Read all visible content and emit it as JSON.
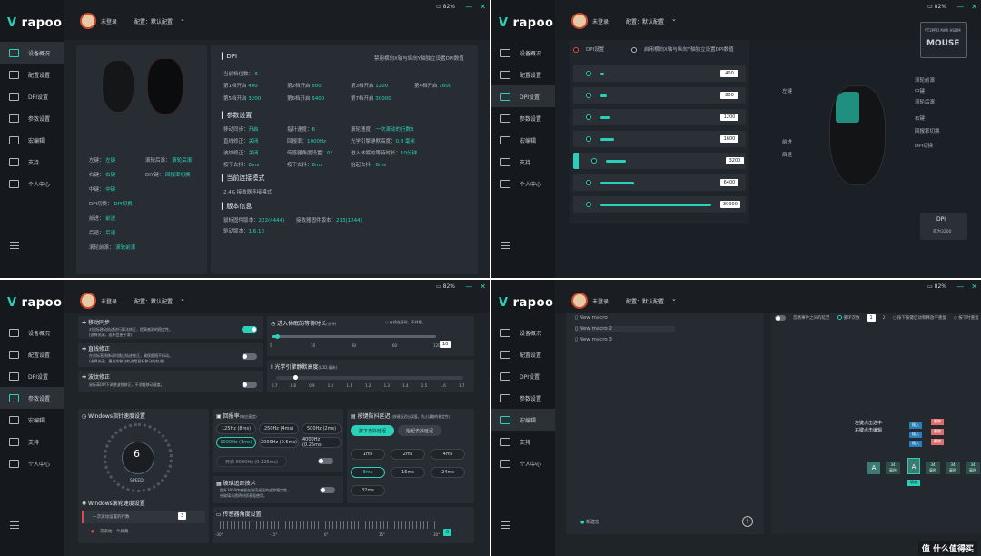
{
  "brand": {
    "logo": "rapoo",
    "accent": "#2ad1b8"
  },
  "header": {
    "user": "未登录",
    "profile": "配置：默认配置",
    "battery": "82%"
  },
  "nav": [
    "设备概况",
    "配置设置",
    "DPI设置",
    "参数设置",
    "宏编辑",
    "支持",
    "个人中心"
  ],
  "q1": {
    "dpi_title": "DPI",
    "dpi_note": "禁用横向X轴与纵向Y轴独立设置DPI数值",
    "dpi_levels_label": "当前档位数：",
    "dpi_levels": "5",
    "dpi_gears": [
      {
        "k": "第1档开启",
        "v": "400"
      },
      {
        "k": "第2档开启",
        "v": "800"
      },
      {
        "k": "第3档开启",
        "v": "1200"
      },
      {
        "k": "第4档开启",
        "v": "1600"
      },
      {
        "k": "第5档开启",
        "v": "3200"
      },
      {
        "k": "第6档开启",
        "v": "6400"
      },
      {
        "k": "第7档开启",
        "v": "30000"
      }
    ],
    "param_title": "参数设置",
    "params": [
      {
        "k": "移动同步：",
        "v": "开启"
      },
      {
        "k": "指针速度：",
        "v": "6"
      },
      {
        "k": "滚轮速度：",
        "v": "一次滚动的行数3"
      },
      {
        "k": "直线修正：",
        "v": "关闭"
      },
      {
        "k": "回报率：",
        "v": "1000Hz"
      },
      {
        "k": "光学引擎静默高度：",
        "v": "0.8 毫米"
      },
      {
        "k": "波纹修正：",
        "v": "关闭"
      },
      {
        "k": "传感器角度设置：",
        "v": "0°"
      },
      {
        "k": "进入休眠的等待时长：",
        "v": "10分钟"
      },
      {
        "k": "按下去抖：",
        "v": "8ms"
      },
      {
        "k": "按下去抖：",
        "v": "8ms"
      },
      {
        "k": "抬起去抖：",
        "v": "8ms"
      }
    ],
    "conn_title": "当前连接模式",
    "conn_mode": "2.4G 接收器连接模式",
    "ver_title": "版本信息",
    "ver": [
      {
        "k": "鼠标固件版本：",
        "v": "222(4444)"
      },
      {
        "k": "接收器固件版本：",
        "v": "213(1244)"
      },
      {
        "k": "驱动版本：",
        "v": "1.6.13"
      }
    ],
    "buttons_left": [
      {
        "k": "左键：",
        "v": "左键"
      },
      {
        "k": "右键：",
        "v": "右键"
      },
      {
        "k": "中键：",
        "v": "中键"
      },
      {
        "k": "DPI切换：",
        "v": "DPI切换"
      },
      {
        "k": "前进：",
        "v": "前进"
      },
      {
        "k": "后退：",
        "v": "后退"
      },
      {
        "k": "滚轮前滚：",
        "v": "滚轮前滚"
      }
    ],
    "buttons_right": [
      {
        "k": "滚轮后滚：",
        "v": "滚轮后滚"
      },
      {
        "k": "DIY键：",
        "v": "回报率切换"
      }
    ]
  },
  "q2": {
    "model": "VT3PRO MAX HSDM",
    "model_big": "MOUSE",
    "opt_dpi": "DPI设置",
    "opt_independent": "启用横向X轴与纵向Y轴独立设置DPI数值",
    "dpi_rows": [
      {
        "value": "400",
        "frac": 0.03
      },
      {
        "value": "800",
        "frac": 0.06
      },
      {
        "value": "1200",
        "frac": 0.09
      },
      {
        "value": "1600",
        "frac": 0.12
      },
      {
        "value": "3200",
        "frac": 0.18
      },
      {
        "value": "6400",
        "frac": 0.3
      },
      {
        "value": "30000",
        "frac": 1.0
      }
    ],
    "labels_left": [
      "左键",
      "前进",
      "后退"
    ],
    "labels_right": [
      "滚轮前滚",
      "中键",
      "滚轮后滚",
      "右键",
      "回报率切换",
      "DPI切换"
    ],
    "dpi_card": {
      "title": "DPI",
      "sub": "或为3200"
    }
  },
  "q3": {
    "move_sync": "移动同步",
    "move_sync_desc1": "对鼠标移动轨迹进行算法修正，提高感测的稳定性。",
    "move_sync_desc2": "(选择关闭，面积会更平滑)",
    "line_fix": "直线修正",
    "line_fix_desc1": "在鼠标直线移动时跳过轨迹修正，确保跟随不抖动。",
    "line_fix_desc2": "(选择关闭，最佳的移动轨迹是鼠标移动的轨迹)",
    "ripple": "波纹修正",
    "ripple_desc": "鼠标高DPI下调整波纹修正，不消耗移动速度。",
    "sleep_title": "进入休眠的等待时长",
    "sleep_unit": "(分钟)",
    "sleep_note": "有线连接时，不休眠。",
    "sleep_ticks": [
      "5",
      "10",
      "30",
      "60",
      "120"
    ],
    "sleep_value": "10",
    "sleep_frac": 0.03,
    "lod_title": "光学引擎静默高度",
    "lod_unit": "(LOD,毫米)",
    "lod_ticks": [
      "0.7",
      "0.8",
      "0.9",
      "1.0",
      "1.1",
      "1.2",
      "1.3",
      "1.4",
      "1.5",
      "1.6",
      "1.7"
    ],
    "lod_frac": 0.1,
    "speed_title": "Windows指针速度设置",
    "speed_value": "6",
    "speed_label": "SPEED",
    "rate_title": "回报率",
    "rate_unit": "(响应速度)",
    "rates": [
      "125Hz (8ms)",
      "250Hz (4ms)",
      "500Hz (2ms)",
      "1000Hz (1ms)",
      "2000Hz (0.5ms)",
      "4000Hz (0.25ms)"
    ],
    "rate_8k": "开启 8000Hz (0.125ms)",
    "glass_title": "玻璃追踪技术",
    "glass_desc1": "提升3950传感器在玻璃桌面的追踪稳定性，",
    "glass_desc2": "在玻璃与透明材质表面使用。",
    "debounce_title": "按键防抖延迟",
    "debounce_note": "(按键延迟出误值，防止误触的稳定性)",
    "debounce_tabs": [
      "按下去抖延迟",
      "抬起去抖延迟"
    ],
    "debounce_opts": [
      "1ms",
      "2ms",
      "4ms",
      "8ms",
      "16ms",
      "24ms",
      "32ms"
    ],
    "scroll_title": "Windows滚轮速度设置",
    "scroll_opt1": "一次滚动设置的行数",
    "scroll_value": "3",
    "scroll_opt2": "一次滚动一个屏幕",
    "angle_title": "传感器角度设置",
    "angle_ticks": [
      "-30°",
      "-15°",
      "0°",
      "15°",
      "30°"
    ],
    "angle_value": "0"
  },
  "q4": {
    "macros": [
      "New macro",
      "New macro 2",
      "New macro 3"
    ],
    "new_macro": "新建宏",
    "opt_ignore": "忽略事件之间的延迟",
    "opt_loop": "循环次数",
    "loop_value": "1",
    "loop_count": "2",
    "opt_press_release": "按下按键启动和释放不重复",
    "opt_hold": "按下时重复",
    "hint1": "左键点击选中",
    "hint2": "右键点击编辑",
    "key": "A",
    "key_delay": "34",
    "key_delay_unit": "毫秒",
    "action_labels": [
      "按下",
      "抬起"
    ],
    "menu_red": [
      "删除",
      "删除",
      "删除"
    ],
    "menu_teal": [
      "插入",
      "插入",
      "插入"
    ],
    "confirm": "确定"
  },
  "watermark": "值 什么值得买"
}
